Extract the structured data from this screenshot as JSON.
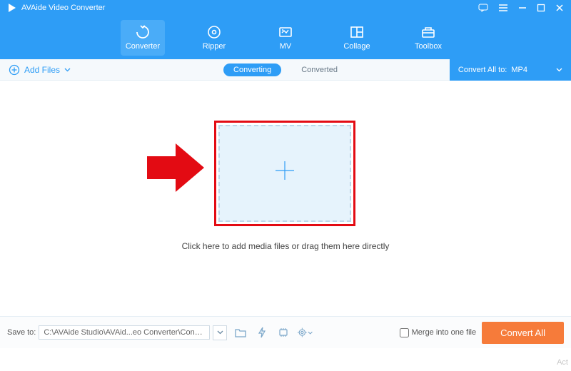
{
  "titlebar": {
    "app_name": "AVAide Video Converter"
  },
  "nav": {
    "items": [
      {
        "label": "Converter"
      },
      {
        "label": "Ripper"
      },
      {
        "label": "MV"
      },
      {
        "label": "Collage"
      },
      {
        "label": "Toolbox"
      }
    ]
  },
  "subbar": {
    "add_files": "Add Files",
    "tabs": {
      "converting": "Converting",
      "converted": "Converted"
    },
    "convert_all_label": "Convert All to:",
    "convert_all_value": "MP4"
  },
  "main": {
    "hint": "Click here to add media files or drag them here directly"
  },
  "bottom": {
    "save_to_label": "Save to:",
    "save_to_path": "C:\\AVAide Studio\\AVAid...eo Converter\\Converted",
    "merge_label": "Merge into one file",
    "convert_btn": "Convert All"
  },
  "watermark": "Act"
}
